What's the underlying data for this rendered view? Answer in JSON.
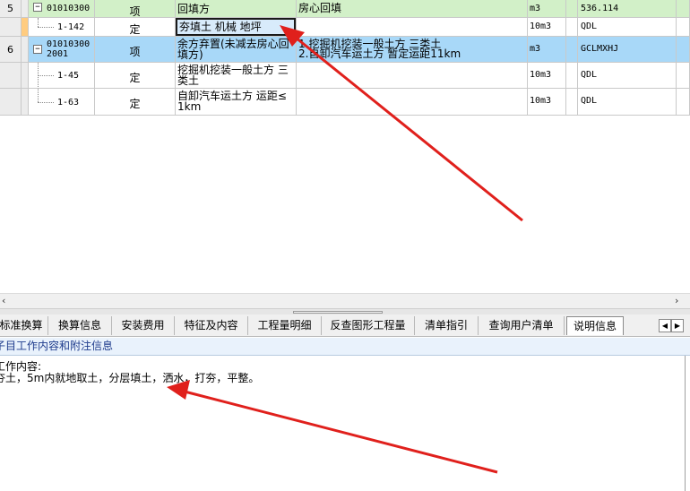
{
  "grid": {
    "rows": [
      {
        "num": "5",
        "code1": "01010300",
        "code2": "",
        "type": "项",
        "name1": "回填方",
        "name2": "",
        "feat1": "房心回填",
        "feat2": "",
        "unit": "m3",
        "qty": "536.114"
      },
      {
        "num": "",
        "code1": "1-142",
        "code2": "",
        "type": "定",
        "name1": "夯填土 机械 地坪",
        "name2": "",
        "feat1": "",
        "feat2": "",
        "unit": "10m3",
        "qty": "QDL"
      },
      {
        "num": "6",
        "code1": "01010300",
        "code2": "2001",
        "type": "项",
        "name1": "余方弃置(未减去房心回",
        "name2": "填方)",
        "feat1": "1.挖掘机挖装一般土方 三类土",
        "feat2": "2.自卸汽车运土方 暂定运距11km",
        "unit": "m3",
        "qty": "GCLMXHJ"
      },
      {
        "num": "",
        "code1": "1-45",
        "code2": "",
        "type": "定",
        "name1": "挖掘机挖装一般土方 三",
        "name2": "类土",
        "feat1": "",
        "feat2": "",
        "unit": "10m3",
        "qty": "QDL"
      },
      {
        "num": "",
        "code1": "1-63",
        "code2": "",
        "type": "定",
        "name1": "自卸汽车运土方 运距≤",
        "name2": "1km",
        "feat1": "",
        "feat2": "",
        "unit": "10m3",
        "qty": "QDL"
      }
    ],
    "expander_symbol": "−"
  },
  "scroll": {
    "left_arrow": "‹",
    "right_arrow": "›"
  },
  "tabs": [
    "标准换算",
    "换算信息",
    "安装费用",
    "特征及内容",
    "工程量明细",
    "反查图形工程量",
    "清单指引",
    "查询用户清单",
    "说明信息"
  ],
  "active_tab": "说明信息",
  "tab_nav": {
    "prev": "◀",
    "next": "▶"
  },
  "panel": {
    "title": "子目工作内容和附注信息",
    "heading": "工作内容:",
    "content": "夯土，5m内就地取土，分层填土，洒水，打夯，平整。"
  },
  "colors": {
    "summary_row": "#d2f0c8",
    "selected_row": "#a8d8f8",
    "arrow": "#e0201c"
  }
}
